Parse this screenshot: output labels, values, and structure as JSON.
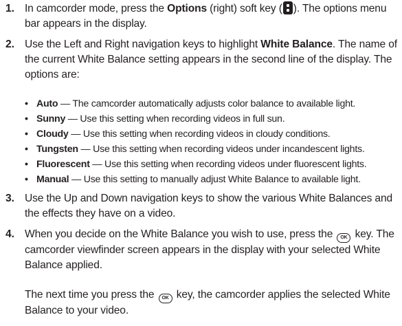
{
  "steps": [
    {
      "number": "1.",
      "before_bold": "In camcorder mode, press the ",
      "bold": "Options",
      "after_bold": " (right) soft key (",
      "icon": "options-soft-key-icon",
      "after_icon": "). The options menu bar appears in the display."
    },
    {
      "number": "2.",
      "before_bold": "Use the Left and Right navigation keys to highlight ",
      "bold": "White Balance",
      "after_bold": ". The name of the current White Balance setting appears in the second line of the display. The options are:"
    },
    {
      "number": "3.",
      "text": "Use the Up and Down navigation keys to show the various White Balances and the effects they have on a video."
    },
    {
      "number": "4.",
      "before_icon": "When you decide on the White Balance you wish to use, press the ",
      "icon": "ok-key-icon",
      "after_icon": " key. The camcorder viewfinder screen appears in the display with your selected White Balance applied."
    }
  ],
  "options": [
    {
      "name": "Auto",
      "desc": " — The camcorder automatically adjusts color balance to available light."
    },
    {
      "name": "Sunny",
      "desc": " — Use this setting when recording videos in full sun."
    },
    {
      "name": "Cloudy",
      "desc": " — Use this setting when recording videos in cloudy conditions."
    },
    {
      "name": "Tungsten",
      "desc": " — Use this setting when recording videos under incandescent lights."
    },
    {
      "name": "Fluorescent",
      "desc": " — Use this setting when recording videos under fluorescent lights."
    },
    {
      "name": "Manual",
      "desc": " — Use this setting to manually adjust White Balance to available light."
    }
  ],
  "bullet_glyph": "•",
  "ok_key_label": "OK",
  "closing": {
    "before_icon": "The next time you press the ",
    "icon": "ok-key-icon",
    "after_icon": " key, the camcorder applies the selected White Balance to your video."
  }
}
